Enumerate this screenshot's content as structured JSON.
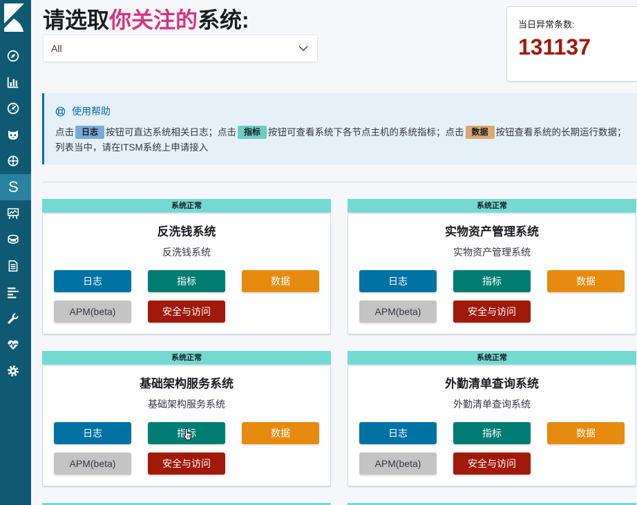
{
  "sidebar": {
    "logo_icon": "kibana-logo-icon",
    "items": [
      {
        "icon": "compass-icon"
      },
      {
        "icon": "bar-chart-icon"
      },
      {
        "icon": "dashboard-gauge-icon"
      },
      {
        "icon": "timelion-icon"
      },
      {
        "icon": "machine-learning-icon"
      },
      {
        "label": "S",
        "active": true
      },
      {
        "icon": "infrastructure-icon"
      },
      {
        "icon": "logs-icon"
      },
      {
        "icon": "document-icon"
      },
      {
        "icon": "apm-icon"
      },
      {
        "icon": "wrench-icon"
      },
      {
        "icon": "heartbeat-icon"
      },
      {
        "icon": "gear-icon"
      }
    ]
  },
  "header": {
    "title_prefix": "请选取",
    "title_highlight": "你关注的",
    "title_suffix": "系统:"
  },
  "system_select": {
    "value": "All",
    "icon": "chevron-down-icon"
  },
  "anomaly": {
    "label": "当日异常条数:",
    "count": "131137"
  },
  "help": {
    "icon": "lifebuoy-icon",
    "title": "使用帮助",
    "line1": {
      "text_a": "点击",
      "badge_logs": "日志",
      "text_b": "按钮可直达系统相关日志；点击",
      "badge_metrics": "指标",
      "text_c": "按钮可查看系统下各节点主机的系统指标；点击",
      "badge_data": "数据",
      "text_d": "按钮查看系统的长期运行数据；"
    },
    "line2": "列表当中，请在ITSM系统上申请接入"
  },
  "buttons": {
    "logs": "日志",
    "metrics": "指标",
    "data": "数据",
    "apm": "APM(beta)",
    "security": "安全与访问"
  },
  "systems": [
    {
      "status": "系统正常",
      "name": "反洗钱系统",
      "description": "反洗钱系统"
    },
    {
      "status": "系统正常",
      "name": "实物资产管理系统",
      "description": "实物资产管理系统"
    },
    {
      "status": "系统正常",
      "name": "基础架构服务系统",
      "description": "基础架构服务系统"
    },
    {
      "status": "系统正常",
      "name": "外勤清单查询系统",
      "description": "外勤清单查询系统"
    }
  ],
  "cursor": {
    "icon": "hand-cursor-icon"
  },
  "colors": {
    "sidebar_bg": "#0f5a72",
    "sidebar_active": "#2a82a1",
    "accent_pink": "#d6347f",
    "anomaly_red": "#a0190b",
    "help_bg": "#e6f0f8",
    "help_accent": "#006bb4",
    "badge_logs": "#79aad9",
    "badge_metrics": "#6dccc1",
    "badge_data": "#d9a971",
    "status_ok": "#74d9d1",
    "btn_logs": "#0072a4",
    "btn_metrics": "#017d73",
    "btn_data": "#e68a10",
    "btn_apm": "#c4c4c4",
    "btn_security": "#a11909"
  }
}
